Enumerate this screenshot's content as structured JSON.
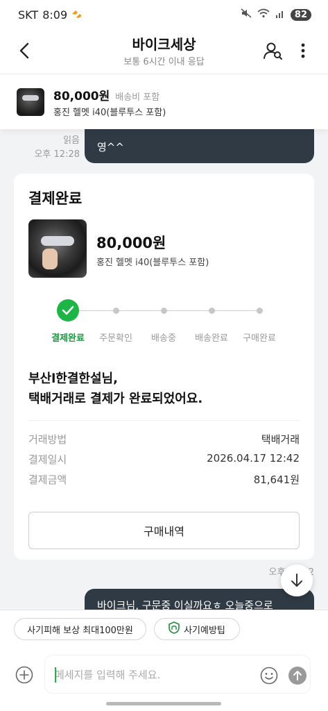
{
  "status_bar": {
    "carrier": "SKT",
    "time": "8:09",
    "battery": "82"
  },
  "header": {
    "title": "바이크세상",
    "subtitle": "보통 6시간 이내 응답"
  },
  "product": {
    "price": "80,000원",
    "shipping": "배송비 포함",
    "name": "홍진 헬멧 i40(블루투스 포함)"
  },
  "messages": {
    "first": {
      "text": "영^^",
      "read": "읽음",
      "time": "오후 12:28"
    },
    "second": {
      "text": "바이크님, 구문중 이실까요ㅎ 오늘중으로",
      "time": "오후 12:32"
    }
  },
  "payment_card": {
    "title": "결제완료",
    "price": "80,000원",
    "product_name": "홍진 헬멧 i40(블루투스 포함)",
    "steps": [
      "결제완료",
      "주문확인",
      "배송중",
      "배송완료",
      "구매완료"
    ],
    "active_step": 0,
    "message_line1": "부산l한결한설님,",
    "message_line2": "택배거래로 결제가 완료되었어요.",
    "rows": [
      {
        "label": "거래방법",
        "value": "택배거래"
      },
      {
        "label": "결제일시",
        "value": "2026.04.17 12:42"
      },
      {
        "label": "결제금액",
        "value": "81,641원"
      }
    ],
    "history_button": "구매내역"
  },
  "chips": {
    "compensation": "사기피해 보상 최대100만원",
    "fraud_tips": "사기예방팁"
  },
  "input": {
    "placeholder": "메세지를 입력해 주세요."
  },
  "colors": {
    "accent_green": "#1db545",
    "bubble_dark": "#2f3a44"
  }
}
